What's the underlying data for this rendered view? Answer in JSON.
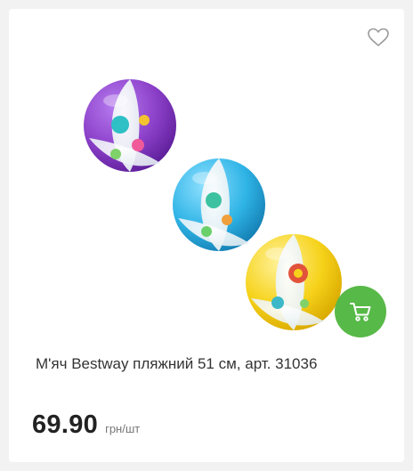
{
  "product": {
    "title": "М'яч Bestway пляжний 51 см, арт. 31036",
    "price": "69.90",
    "unit": "грн/шт",
    "image_alt": "beach-balls-image"
  },
  "actions": {
    "favorite_icon": "heart-outline-icon",
    "cart_icon": "cart-icon"
  },
  "colors": {
    "cart_button": "#57b947",
    "price_text": "#222222",
    "ball_purple": "#8b3fc8",
    "ball_blue": "#2fb4e6",
    "ball_yellow": "#f6d21a"
  }
}
